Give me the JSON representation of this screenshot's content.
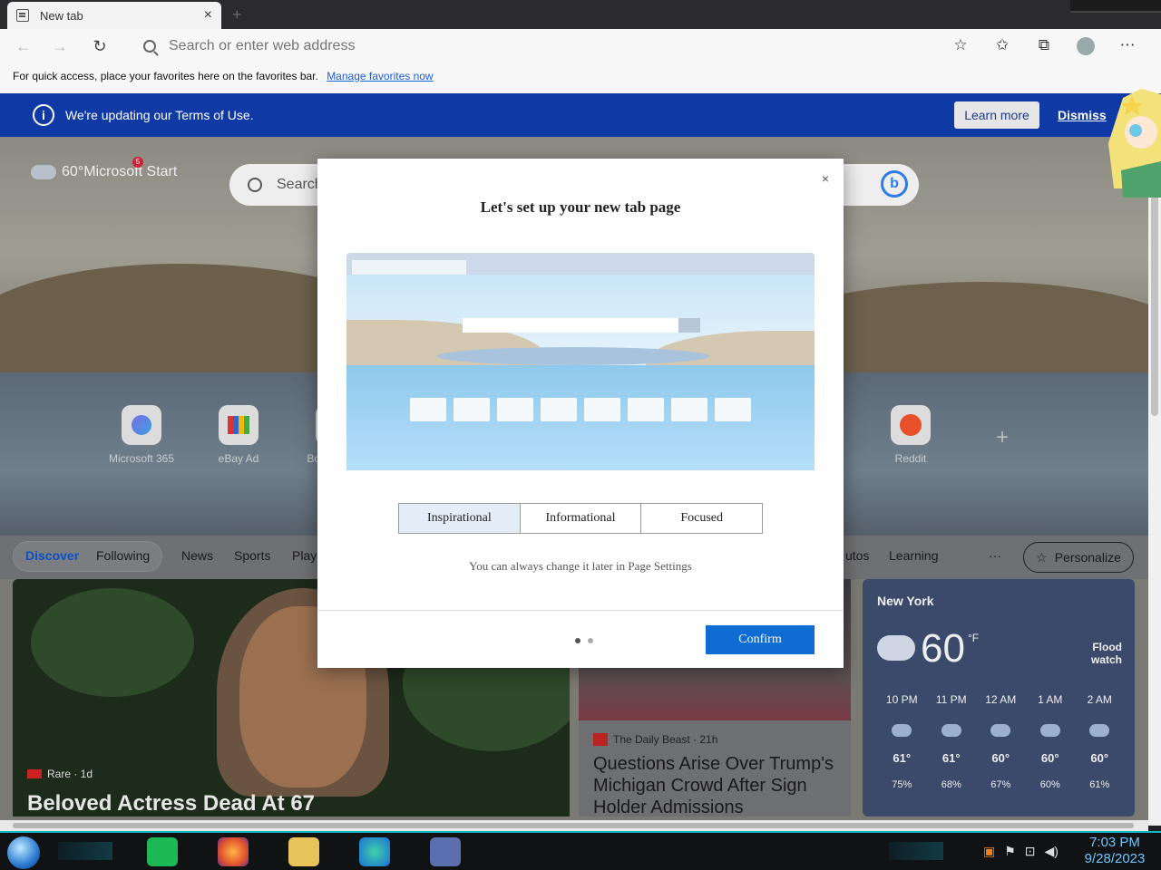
{
  "browser": {
    "tab_title": "New tab",
    "tab_close": "×",
    "new_tab": "+",
    "back": "←",
    "forward": "→",
    "refresh": "↻",
    "address_placeholder": "Search or enter web address"
  },
  "favorites_bar": {
    "text": "For quick access, place your favorites here on the favorites bar.",
    "link": "Manage favorites now"
  },
  "banner": {
    "text": "We're updating our Terms of Use.",
    "learn_more": "Learn more",
    "dismiss": "Dismiss"
  },
  "newtab": {
    "brand": "60°Microsoft Start",
    "notification_count": "5",
    "search_placeholder": "Search",
    "tiles": [
      {
        "label": "Microsoft 365"
      },
      {
        "label": "eBay  Ad"
      },
      {
        "label": "Boo"
      },
      {
        "label": "Reddit"
      }
    ],
    "feed_tabs": [
      "Discover",
      "Following",
      "News",
      "Sports",
      "Play",
      "utos",
      "Learning"
    ],
    "more": "···",
    "personalize": "Personalize"
  },
  "cards": {
    "main": {
      "source": "Rare · 1d",
      "title": "Beloved Actress Dead At 67"
    },
    "second": {
      "source": "The Daily Beast · 21h",
      "title": "Questions Arise Over Trump's Michigan Crowd After Sign Holder Admissions"
    }
  },
  "weather": {
    "city": "New York",
    "temp": "60",
    "unit": "°F",
    "alert": "Flood watch",
    "hours": [
      {
        "time": "10 PM",
        "temp": "61°",
        "precip": "75%"
      },
      {
        "time": "11 PM",
        "temp": "61°",
        "precip": "68%"
      },
      {
        "time": "12 AM",
        "temp": "60°",
        "precip": "67%"
      },
      {
        "time": "1 AM",
        "temp": "60°",
        "precip": "60%"
      },
      {
        "time": "2 AM",
        "temp": "60°",
        "precip": "61%"
      }
    ]
  },
  "modal": {
    "title": "Let's set up your new tab page",
    "close": "×",
    "options": [
      "Inspirational",
      "Informational",
      "Focused"
    ],
    "selected": "Inspirational",
    "hint": "You can always change it later in Page Settings",
    "confirm": "Confirm"
  },
  "taskbar": {
    "time": "7:03 PM",
    "date": "9/28/2023"
  }
}
